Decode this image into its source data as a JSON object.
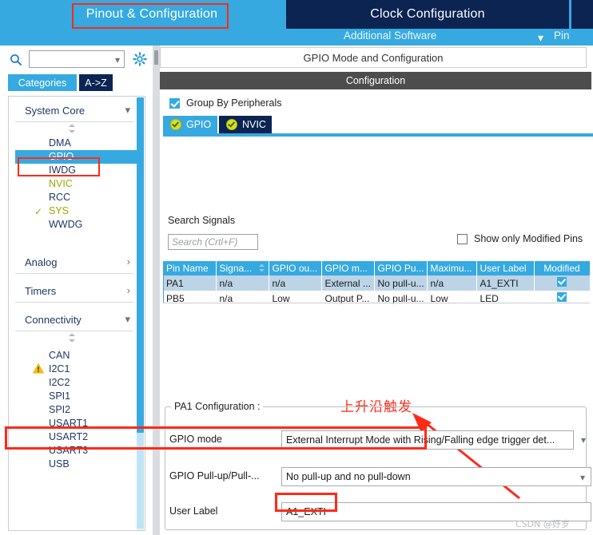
{
  "topbar": {
    "tabs": [
      {
        "id": "pinout",
        "label": "Pinout & Configuration",
        "active": true
      },
      {
        "id": "clock",
        "label": "Clock Configuration",
        "active": false
      }
    ],
    "additional_software": "Additional Software",
    "pin_right_partial": "Pin",
    "chevron_icon": "chevron-down-icon",
    "accent": "#36a9e1",
    "tab_inactive_bg": "#0b2452",
    "highlight_color": "#ff2a17"
  },
  "sidebar": {
    "search": {
      "value": "",
      "chevron": "chevron-down-icon"
    },
    "gear_icon": "gear-icon",
    "search_icon": "search-icon",
    "view_buttons": [
      {
        "id": "categories",
        "label": "Categories",
        "active": true
      },
      {
        "id": "a-to-z",
        "label": "A->Z",
        "active": false
      }
    ],
    "groups": [
      {
        "name": "System Core",
        "expanded": true,
        "chevron": "chevron-down-icon",
        "items": [
          {
            "label": "DMA",
            "state": "none",
            "selected": false
          },
          {
            "label": "GPIO",
            "state": "none",
            "selected": true
          },
          {
            "label": "IWDG",
            "state": "none",
            "selected": false
          },
          {
            "label": "NVIC",
            "state": "partial",
            "selected": false
          },
          {
            "label": "RCC",
            "state": "none",
            "selected": false
          },
          {
            "label": "SYS",
            "state": "configured",
            "selected": false
          },
          {
            "label": "WWDG",
            "state": "none",
            "selected": false
          }
        ]
      },
      {
        "name": "Analog",
        "expanded": false,
        "chevron": "chevron-right-icon",
        "items": []
      },
      {
        "name": "Timers",
        "expanded": false,
        "chevron": "chevron-right-icon",
        "items": []
      },
      {
        "name": "Connectivity",
        "expanded": true,
        "chevron": "chevron-down-icon",
        "items": [
          {
            "label": "CAN",
            "state": "none",
            "selected": false
          },
          {
            "label": "I2C1",
            "state": "warning",
            "selected": false
          },
          {
            "label": "I2C2",
            "state": "none",
            "selected": false
          },
          {
            "label": "SPI1",
            "state": "none",
            "selected": false
          },
          {
            "label": "SPI2",
            "state": "none",
            "selected": false
          },
          {
            "label": "USART1",
            "state": "none",
            "selected": false
          },
          {
            "label": "USART2",
            "state": "none",
            "selected": false
          },
          {
            "label": "USART3",
            "state": "none",
            "selected": false
          },
          {
            "label": "USB",
            "state": "none",
            "selected": false
          }
        ]
      }
    ]
  },
  "main": {
    "mode_header": "GPIO Mode and Configuration",
    "configuration_band": "Configuration",
    "group_by_peripherals": {
      "label": "Group By Peripherals",
      "checked": true
    },
    "sub_tabs": [
      {
        "id": "gpio",
        "label": "GPIO",
        "active": true,
        "badge": "check-badge-icon"
      },
      {
        "id": "nvic",
        "label": "NVIC",
        "active": false,
        "badge": "check-badge-icon"
      }
    ],
    "search_signals": {
      "label": "Search Signals",
      "placeholder": "Search (Crtl+F)",
      "value": ""
    },
    "show_only_modified": {
      "label": "Show only Modified Pins",
      "checked": false
    },
    "table": {
      "columns": [
        "Pin Name",
        "Signa...",
        "GPIO ou...",
        "GPIO m...",
        "GPIO Pu...",
        "Maximu...",
        "User Label",
        "Modified"
      ],
      "sorted_column_index": 1,
      "rows": [
        {
          "cells": [
            "PA1",
            "n/a",
            "n/a",
            "External ...",
            "No pull-u...",
            "n/a",
            "A1_EXTI"
          ],
          "modified": true
        },
        {
          "cells": [
            "PB5",
            "n/a",
            "Low",
            "Output P...",
            "No pull-u...",
            "Low",
            "LED"
          ],
          "modified": true
        }
      ]
    },
    "annotation": {
      "text": "上升沿触发",
      "color": "#ff2a17",
      "arrow": "arrow-up-left-icon"
    },
    "pa1_config": {
      "legend": "PA1 Configuration :",
      "fields": [
        {
          "label": "GPIO mode",
          "value": "External Interrupt Mode with Rising/Falling edge trigger det...",
          "type": "dropdown",
          "highlighted": true
        },
        {
          "label": "GPIO Pull-up/Pull-...",
          "value": "No pull-up and no pull-down",
          "type": "dropdown",
          "highlighted": false
        },
        {
          "label": "User Label",
          "value": "A1_EXTI",
          "type": "text",
          "highlighted": true
        }
      ]
    },
    "watermark": "CSDN @妤岁"
  }
}
